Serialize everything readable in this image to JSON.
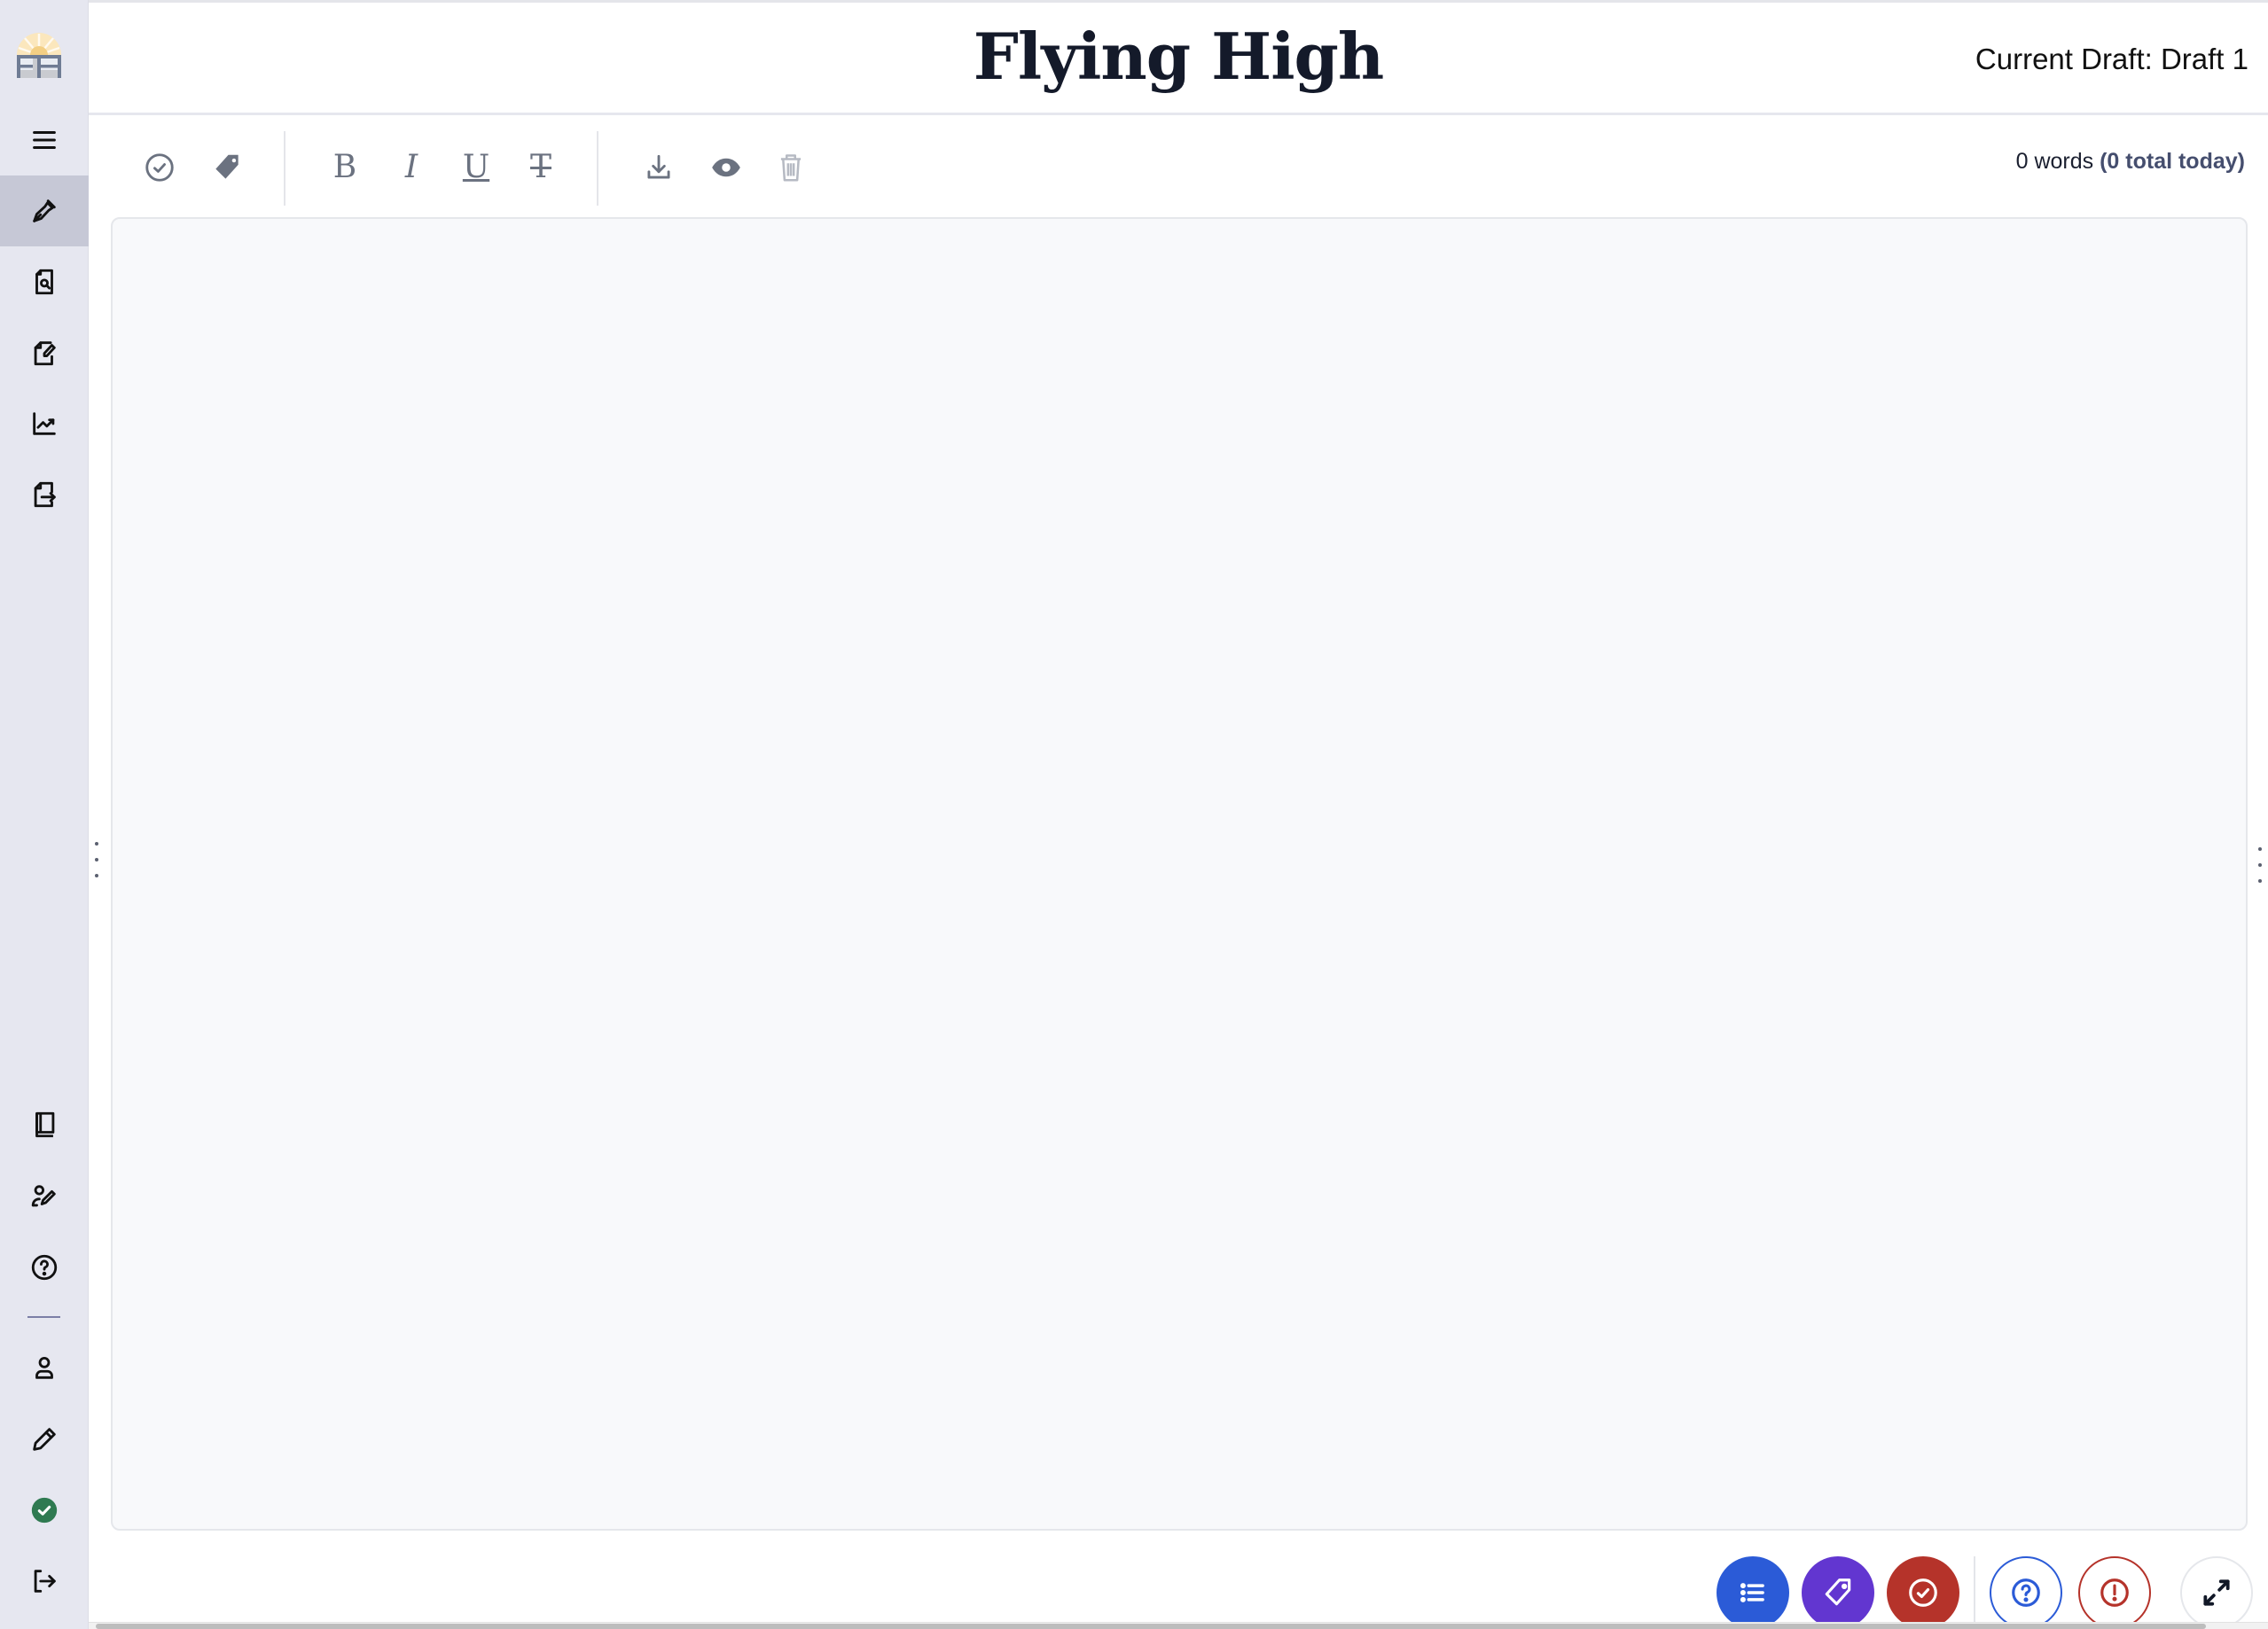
{
  "app": {
    "logo": "flying-high-logo"
  },
  "header": {
    "title": "Flying High",
    "current_draft": "Current Draft: Draft 1"
  },
  "sidebar": {
    "top_items": [
      {
        "name": "menu",
        "icon": "hamburger-icon",
        "active": false
      },
      {
        "name": "write",
        "icon": "pen-nib-icon",
        "active": true
      },
      {
        "name": "review",
        "icon": "file-search-icon",
        "active": false
      },
      {
        "name": "edit",
        "icon": "file-edit-icon",
        "active": false
      },
      {
        "name": "stats",
        "icon": "chart-line-icon",
        "active": false
      },
      {
        "name": "export",
        "icon": "file-export-icon",
        "active": false
      }
    ],
    "bottom_items": [
      {
        "name": "guide",
        "icon": "book-icon"
      },
      {
        "name": "coach",
        "icon": "user-pen-icon"
      },
      {
        "name": "help",
        "icon": "help-circle-icon"
      },
      {
        "name": "profile",
        "icon": "user-icon"
      },
      {
        "name": "pencil",
        "icon": "pencil-icon"
      },
      {
        "name": "saved-status",
        "icon": "check-circle-green-icon"
      },
      {
        "name": "logout",
        "icon": "logout-icon"
      }
    ]
  },
  "toolbar": {
    "buttons": [
      {
        "name": "check",
        "icon": "check-circle-icon"
      },
      {
        "name": "tag",
        "icon": "tag-icon"
      },
      {
        "name": "bold",
        "label": "B"
      },
      {
        "name": "italic",
        "label": "I"
      },
      {
        "name": "underline",
        "label": "U"
      },
      {
        "name": "clear-format",
        "label": "T"
      },
      {
        "name": "download",
        "icon": "download-icon"
      },
      {
        "name": "preview",
        "icon": "eye-icon"
      },
      {
        "name": "delete",
        "icon": "trash-icon",
        "disabled": true
      }
    ],
    "word_count": "0 words",
    "total_today": "(0 total today)"
  },
  "editor": {
    "content": ""
  },
  "bottom_actions": [
    {
      "name": "outline",
      "icon": "list-icon",
      "color": "#2b5bd7"
    },
    {
      "name": "tags",
      "icon": "tag-icon",
      "color": "#6236d0"
    },
    {
      "name": "checks",
      "icon": "check-circle-icon",
      "color": "#b5332a"
    },
    {
      "name": "help",
      "icon": "help-circle-icon",
      "color": "#2b5bd7"
    },
    {
      "name": "alerts",
      "icon": "alert-circle-icon",
      "color": "#b5332a"
    },
    {
      "name": "fullscreen",
      "icon": "expand-icon",
      "color": "#111827"
    }
  ]
}
